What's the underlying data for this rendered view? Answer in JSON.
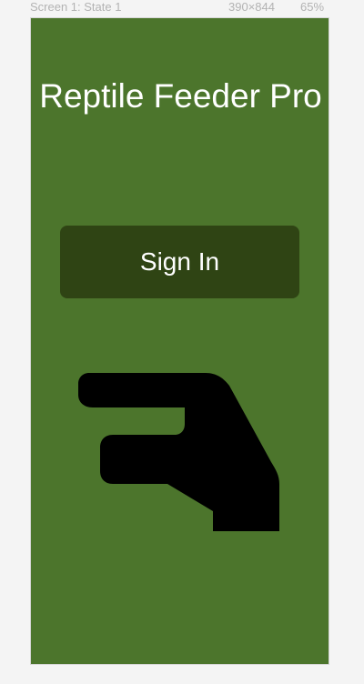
{
  "canvas": {
    "screen_label": "Screen 1: State 1",
    "dimensions": "390×844",
    "zoom": "65%"
  },
  "app": {
    "title": "Reptile Feeder Pro",
    "signin_label": "Sign In",
    "illustration_icon": "pointing-hand-icon"
  },
  "colors": {
    "background": "#4c752c",
    "button": "#2f4414",
    "text": "#ffffff"
  }
}
